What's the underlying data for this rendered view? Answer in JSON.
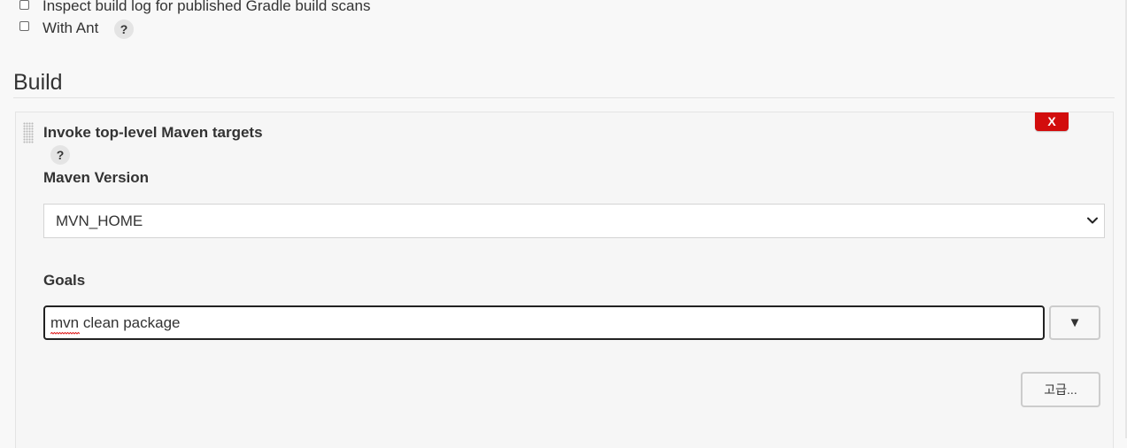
{
  "options": {
    "inspect_build_log": {
      "label": "Inspect build log for published Gradle build scans",
      "checked": false
    },
    "with_ant": {
      "label": "With Ant",
      "checked": false,
      "help": "?"
    }
  },
  "section": {
    "title": "Build"
  },
  "build_step": {
    "title": "Invoke top-level Maven targets",
    "help": "?",
    "delete_label": "X",
    "maven_version": {
      "label": "Maven Version",
      "selected": "MVN_HOME"
    },
    "goals": {
      "label": "Goals",
      "value": "mvn clean package",
      "expand_label": "▼"
    },
    "advanced_label": "고급..."
  },
  "colors": {
    "delete_red": "#d20d0d",
    "text": "#333333",
    "background": "#f8f8f8"
  },
  "icons": {
    "checkbox": "checkbox-icon",
    "help": "help-icon",
    "drag": "drag-handle-icon",
    "chevron": "chevron-down-icon"
  }
}
